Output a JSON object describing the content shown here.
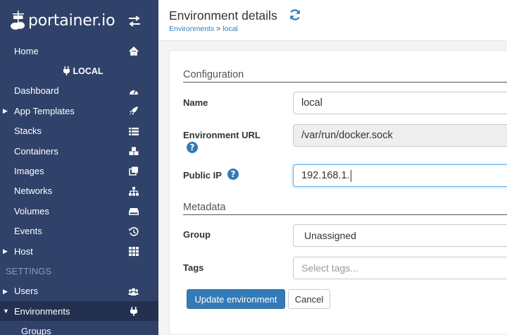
{
  "app": {
    "logo_text": "portainer.io"
  },
  "sidebar": {
    "home": "Home",
    "environment_name": "LOCAL",
    "items": [
      {
        "label": "Dashboard",
        "icon": "tachometer-icon"
      },
      {
        "label": "App Templates",
        "icon": "rocket-icon"
      },
      {
        "label": "Stacks",
        "icon": "list-icon"
      },
      {
        "label": "Containers",
        "icon": "cubes-icon"
      },
      {
        "label": "Images",
        "icon": "clone-icon"
      },
      {
        "label": "Networks",
        "icon": "sitemap-icon"
      },
      {
        "label": "Volumes",
        "icon": "hdd-icon"
      },
      {
        "label": "Events",
        "icon": "history-icon"
      },
      {
        "label": "Host",
        "icon": "th-icon"
      }
    ],
    "settings_header": "SETTINGS",
    "settings_items": [
      {
        "label": "Users",
        "icon": "users-icon"
      },
      {
        "label": "Environments",
        "icon": "plug-icon"
      },
      {
        "label": "Groups"
      }
    ]
  },
  "header": {
    "title": "Environment details",
    "breadcrumb_parent": "Environments",
    "breadcrumb_sep": ">",
    "breadcrumb_current": "local"
  },
  "form": {
    "configuration_title": "Configuration",
    "name_label": "Name",
    "name_value": "local",
    "url_label": "Environment URL",
    "url_value": "/var/run/docker.sock",
    "public_ip_label": "Public IP",
    "public_ip_value": "192.168.1.",
    "metadata_title": "Metadata",
    "group_label": "Group",
    "group_value": "Unassigned",
    "tags_label": "Tags",
    "tags_placeholder": "Select tags...",
    "update_button": "Update environment",
    "cancel_button": "Cancel",
    "help_glyph": "?"
  },
  "colors": {
    "sidebar_bg": "#30426a",
    "sidebar_active": "#233050",
    "primary": "#337ab7",
    "content_bg": "#f4f4f4"
  }
}
